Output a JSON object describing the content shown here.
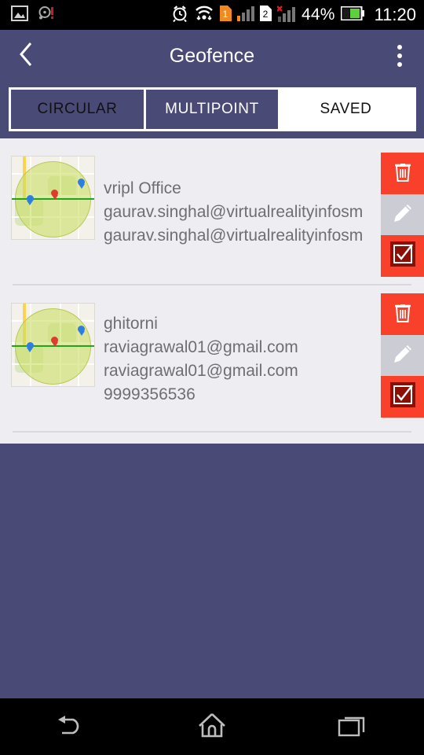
{
  "status_bar": {
    "icons_left": [
      "image-icon",
      "disc-warning-icon"
    ],
    "icons_right": [
      "alarm-icon",
      "wifi-icon",
      "sim1-icon",
      "signal-icon",
      "sim2-icon",
      "no-signal-icon"
    ],
    "sim1_label": "1",
    "sim2_label": "2",
    "battery_percent": "44%",
    "time": "11:20"
  },
  "appbar": {
    "title": "Geofence",
    "back_icon": "back-chevron-icon",
    "overflow_icon": "overflow-menu-icon"
  },
  "tabs": [
    {
      "label": "CIRCULAR",
      "selected": false
    },
    {
      "label": "MULTIPOINT",
      "selected": false
    },
    {
      "label": "SAVED",
      "selected": true
    }
  ],
  "list": {
    "items": [
      {
        "thumbnail": "map-thumbnail",
        "lines": [
          "vripl Office",
          "gaurav.singhal@virtualrealityinfosm",
          "gaurav.singhal@virtualrealityinfosm"
        ],
        "actions": [
          {
            "name": "delete-button",
            "icon": "trash-icon"
          },
          {
            "name": "edit-button",
            "icon": "pencil-icon"
          },
          {
            "name": "select-button",
            "icon": "checkbox-checked-icon"
          }
        ]
      },
      {
        "thumbnail": "map-thumbnail",
        "lines": [
          "ghitorni",
          "raviagrawal01@gmail.com",
          "raviagrawal01@gmail.com",
          "9999356536"
        ],
        "actions": [
          {
            "name": "delete-button",
            "icon": "trash-icon"
          },
          {
            "name": "edit-button",
            "icon": "pencil-icon"
          },
          {
            "name": "select-button",
            "icon": "checkbox-checked-icon"
          }
        ]
      }
    ]
  },
  "nav_bar": {
    "back": "back-nav-icon",
    "home": "home-nav-icon",
    "recents": "recents-nav-icon"
  },
  "colors": {
    "primary_purple": "#4a4a77",
    "list_bg": "#eeeef2",
    "danger_red": "#f9402a",
    "edit_gray": "#ccccd4",
    "text_gray": "#6e6e73"
  }
}
